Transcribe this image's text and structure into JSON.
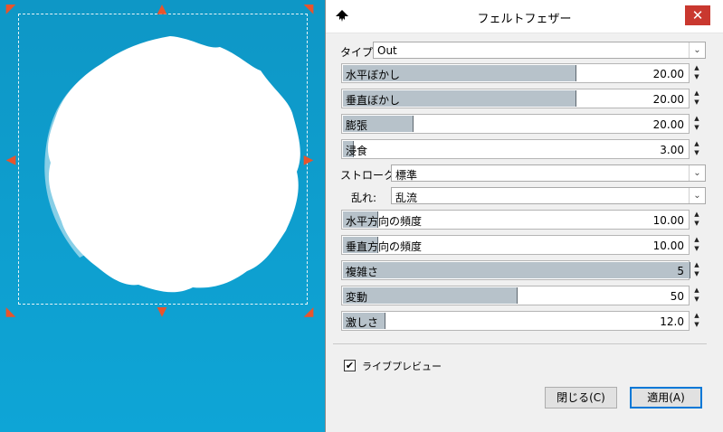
{
  "dialog": {
    "title": "フェルトフェザー",
    "close_symbol": "✕",
    "type": {
      "label": "タイプ:",
      "value": "Out"
    },
    "stroke": {
      "label": "ストローク:",
      "value": "標準"
    },
    "turbulence": {
      "label": "乱れ:",
      "value": "乱流"
    },
    "sliders": [
      {
        "label": "水平ぼかし",
        "value": "20.00",
        "fill": 0.67
      },
      {
        "label": "垂直ぼかし",
        "value": "20.00",
        "fill": 0.67
      },
      {
        "label": "膨張",
        "value": "20.00",
        "fill": 0.2
      },
      {
        "label": "浸食",
        "value": "3.00",
        "fill": 0.03
      },
      {
        "label": "水平方向の頻度",
        "value": "10.00",
        "fill": 0.1
      },
      {
        "label": "垂直方向の頻度",
        "value": "10.00",
        "fill": 0.1
      },
      {
        "label": "複雑さ",
        "value": "5",
        "fill": 1.0
      },
      {
        "label": "変動",
        "value": "50",
        "fill": 0.5
      },
      {
        "label": "激しさ",
        "value": "12.0",
        "fill": 0.12
      }
    ],
    "live_preview": {
      "label": "ライブプレビュー",
      "checked": true
    },
    "buttons": {
      "close": "閉じる(C)",
      "apply": "適用(A)"
    }
  },
  "colors": {
    "accent": "#0078d7",
    "handle": "#e8542c",
    "close": "#c9382f",
    "canvas": "#0ea5d6"
  }
}
